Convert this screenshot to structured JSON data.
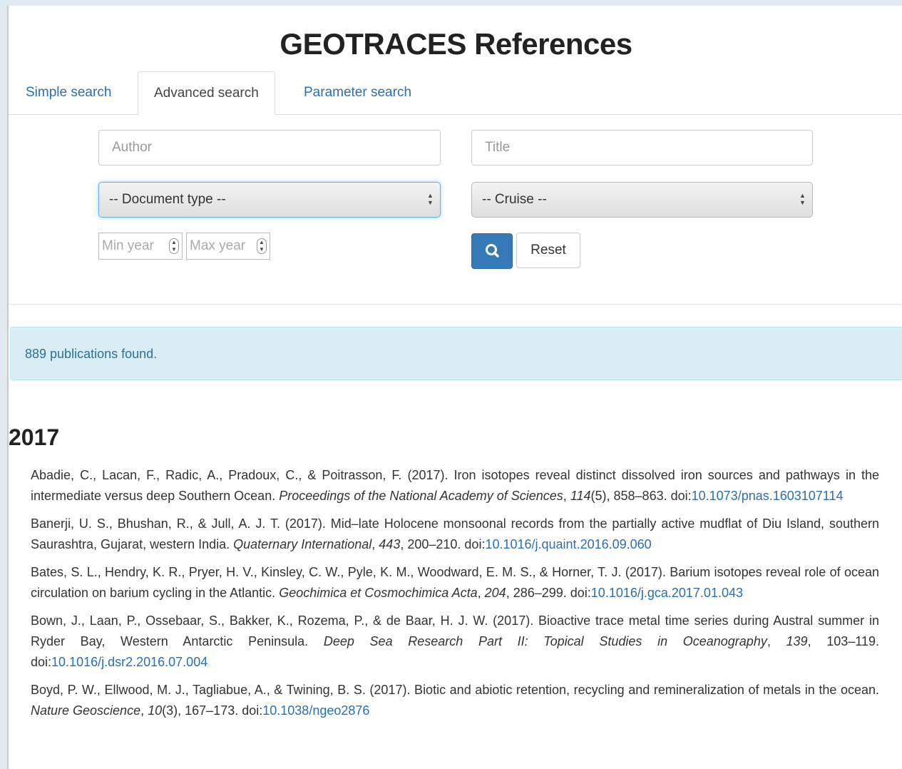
{
  "page": {
    "title": "GEOTRACES References"
  },
  "tabs": [
    {
      "label": "Simple search"
    },
    {
      "label": "Advanced search"
    },
    {
      "label": "Parameter search"
    }
  ],
  "form": {
    "author_placeholder": "Author",
    "title_placeholder": "Title",
    "document_type": "-- Document type --",
    "cruise": "-- Cruise --",
    "min_year_placeholder": "Min year",
    "max_year_placeholder": "Max year",
    "reset_label": "Reset",
    "search_icon": "search-icon"
  },
  "results": {
    "count_text": "889 publications found.",
    "year_heading": "2017"
  },
  "references": [
    {
      "authors_year": "Abadie, C., Lacan, F., Radic, A., Pradoux, C., & Poitrasson, F. (2017). Iron isotopes reveal distinct dissolved iron sources and pathways in the intermediate versus deep Southern Ocean.",
      "journal": "Proceedings of the National Academy of Sciences",
      "volume": "114",
      "issue_pages": "(5), 858–863. doi:",
      "doi": "10.1073/pnas.1603107114"
    },
    {
      "authors_year": "Banerji, U. S., Bhushan, R., & Jull, A. J. T. (2017). Mid–late Holocene monsoonal records from the partially active mudflat of Diu Island, southern Saurashtra, Gujarat, western India.",
      "journal": "Quaternary International",
      "volume": "443",
      "issue_pages": ", 200–210. doi:",
      "doi": "10.1016/j.quaint.2016.09.060"
    },
    {
      "authors_year": "Bates, S. L., Hendry, K. R., Pryer, H. V., Kinsley, C. W., Pyle, K. M., Woodward, E. M. S., & Horner, T. J. (2017). Barium isotopes reveal role of ocean circulation on barium cycling in the Atlantic.",
      "journal": "Geochimica et Cosmochimica Acta",
      "volume": "204",
      "issue_pages": ", 286–299. doi:",
      "doi": "10.1016/j.gca.2017.01.043"
    },
    {
      "authors_year": "Bown, J., Laan, P., Ossebaar, S., Bakker, K., Rozema, P., & de Baar, H. J. W. (2017). Bioactive trace metal time series during Austral summer in Ryder Bay, Western Antarctic Peninsula.",
      "journal": "Deep Sea Research Part II: Topical Studies in Oceanography",
      "volume": "139",
      "issue_pages": ", 103–119. doi:",
      "doi": "10.1016/j.dsr2.2016.07.004"
    },
    {
      "authors_year": "Boyd, P. W., Ellwood, M. J., Tagliabue, A., & Twining, B. S. (2017). Biotic and abiotic retention, recycling and remineralization of metals in the ocean.",
      "journal": "Nature Geoscience",
      "volume": "10",
      "issue_pages": "(3), 167–173. doi:",
      "doi": "10.1038/ngeo2876"
    }
  ]
}
